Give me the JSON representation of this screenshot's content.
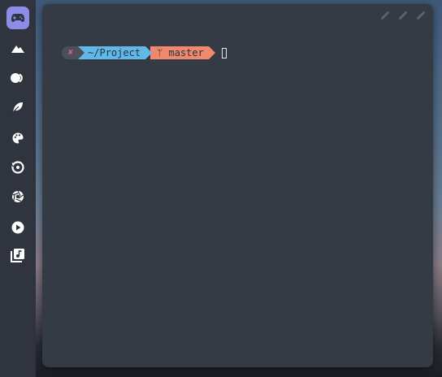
{
  "dock": {
    "items": [
      {
        "name": "gamepad",
        "active": true
      },
      {
        "name": "mountain",
        "active": false
      },
      {
        "name": "toggle",
        "active": false
      },
      {
        "name": "leaf",
        "active": false
      },
      {
        "name": "palette",
        "active": false
      },
      {
        "name": "history",
        "active": false
      },
      {
        "name": "aperture",
        "active": false
      },
      {
        "name": "play",
        "active": false
      },
      {
        "name": "music-library",
        "active": false
      }
    ]
  },
  "terminal": {
    "prompt": {
      "status_symbol": "✘",
      "path": "~/Project",
      "git_branch": "ᛘ master"
    }
  },
  "colors": {
    "accent": "#8d8de8",
    "terminal_bg": "#353b45",
    "path_segment": "#5fb8e8",
    "git_segment": "#f0886e",
    "status_segment": "#4a4f5a"
  }
}
